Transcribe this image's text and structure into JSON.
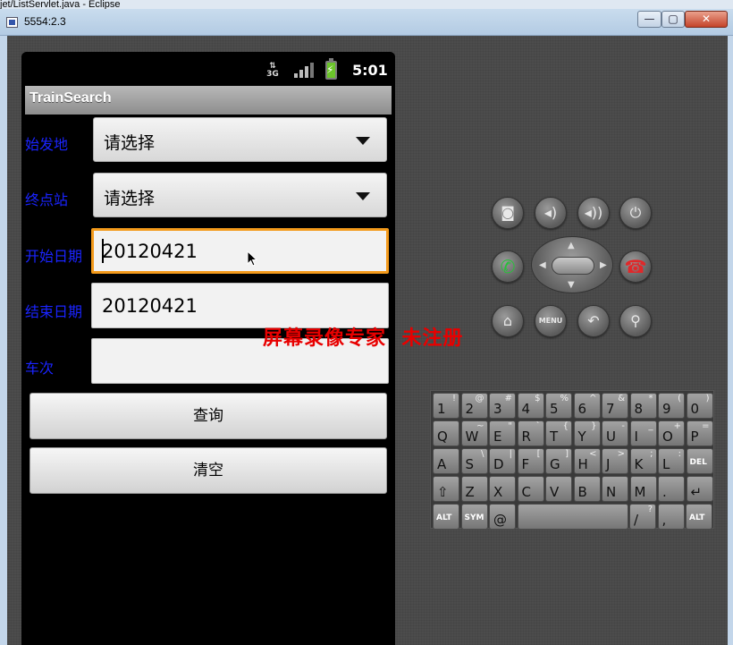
{
  "window": {
    "background_title": "jet/ListServlet.java - Eclipse",
    "title": "5554:2.3",
    "minimize_glyph": "—",
    "maximize_glyph": "▢",
    "close_glyph": "✕"
  },
  "statusbar": {
    "network": "3G",
    "time": "5:01"
  },
  "app": {
    "title": "TrainSearch",
    "fields": {
      "origin_label": "始发地",
      "origin_value": "请选择",
      "destination_label": "终点站",
      "destination_value": "请选择",
      "start_date_label": "开始日期",
      "start_date_value": "20120421",
      "end_date_label": "结束日期",
      "end_date_value": "20120421",
      "train_no_label": "车次",
      "train_no_value": ""
    },
    "buttons": {
      "query": "查询",
      "clear": "清空"
    }
  },
  "watermark": "屏幕录像专家  未注册",
  "hardware": {
    "menu_label": "MENU"
  },
  "keyboard": {
    "row1": [
      [
        "1",
        "!"
      ],
      [
        "2",
        "@"
      ],
      [
        "3",
        "#"
      ],
      [
        "4",
        "$"
      ],
      [
        "5",
        "%"
      ],
      [
        "6",
        "^"
      ],
      [
        "7",
        "&"
      ],
      [
        "8",
        "*"
      ],
      [
        "9",
        "("
      ],
      [
        "0",
        ")"
      ]
    ],
    "row2": [
      [
        "Q",
        ""
      ],
      [
        "W",
        "~"
      ],
      [
        "E",
        "\""
      ],
      [
        "R",
        "`"
      ],
      [
        "T",
        "{"
      ],
      [
        "Y",
        "}"
      ],
      [
        "U",
        "-"
      ],
      [
        "I",
        "_"
      ],
      [
        "O",
        "+"
      ],
      [
        "P",
        "="
      ]
    ],
    "row3": [
      [
        "A",
        ""
      ],
      [
        "S",
        "\\"
      ],
      [
        "D",
        "|"
      ],
      [
        "F",
        "["
      ],
      [
        "G",
        "]"
      ],
      [
        "H",
        "<"
      ],
      [
        "J",
        ">"
      ],
      [
        "K",
        ";"
      ],
      [
        "L",
        ":"
      ],
      [
        "DEL",
        ""
      ]
    ],
    "row4": [
      [
        "⇧",
        ""
      ],
      [
        "Z",
        ""
      ],
      [
        "X",
        ""
      ],
      [
        "C",
        ""
      ],
      [
        "V",
        ""
      ],
      [
        "B",
        ""
      ],
      [
        "N",
        ""
      ],
      [
        "M",
        ""
      ],
      [
        ".",
        ""
      ],
      [
        "↵",
        ""
      ]
    ],
    "row5": {
      "alt_left": "ALT",
      "sym": "SYM",
      "at": "@",
      "slash": "/",
      "question": "?",
      "comma": ",",
      "alt_right": "ALT"
    }
  },
  "colors": {
    "label_blue": "#1a24ff",
    "focus_orange": "#f39a1b",
    "watermark_red": "#e80000"
  }
}
